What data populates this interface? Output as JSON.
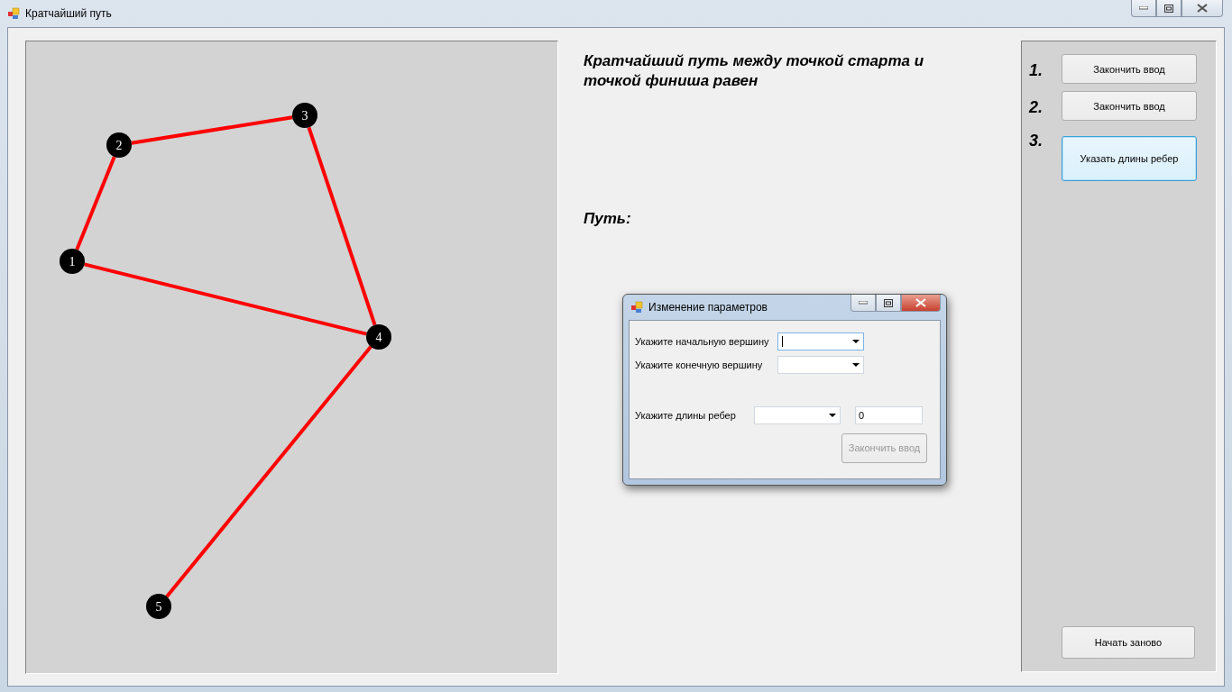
{
  "window": {
    "title": "Кратчайший путь"
  },
  "graph": {
    "nodes": [
      {
        "label": "1"
      },
      {
        "label": "2"
      },
      {
        "label": "3"
      },
      {
        "label": "4"
      },
      {
        "label": "5"
      }
    ]
  },
  "result": {
    "heading": "Кратчайший путь между точкой старта и точкой финиша равен",
    "path_label": "Путь:"
  },
  "steps": [
    {
      "number": "1.",
      "button": "Закончить ввод",
      "focused": false
    },
    {
      "number": "2.",
      "button": "Закончить ввод",
      "focused": false
    },
    {
      "number": "3.",
      "button": "Указать длины ребер",
      "focused": true
    }
  ],
  "restart_button": "Начать заново",
  "dialog": {
    "title": "Изменение параметров",
    "start_label": "Укажите начальную вершину",
    "end_label": "Укажите конечную вершину",
    "length_label": "Укажите длины ребер",
    "length_value": "0",
    "finish_button": "Закончить ввод",
    "finish_disabled": true
  }
}
